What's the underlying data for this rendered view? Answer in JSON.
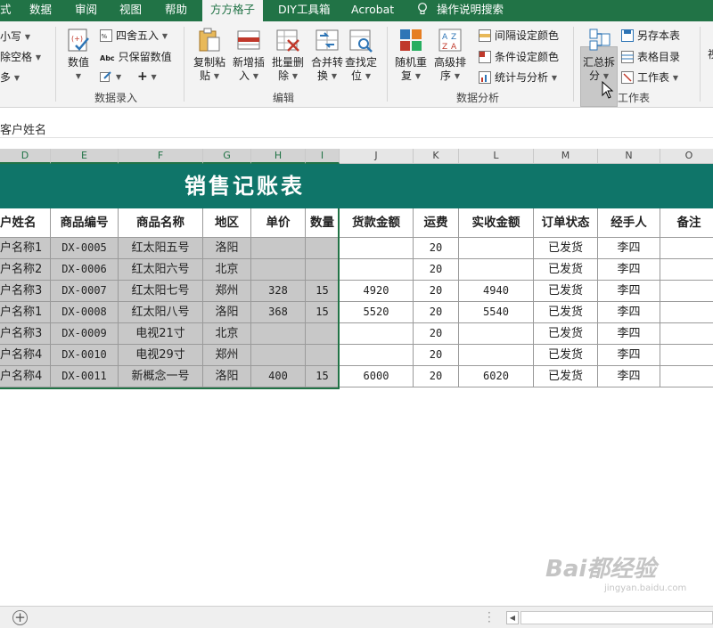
{
  "tabs": [
    "式",
    "数据",
    "审阅",
    "视图",
    "帮助",
    "方方格子",
    "DIY工具箱",
    "Acrobat",
    "操作说明搜索"
  ],
  "ribbon": {
    "left_items": [
      "小写",
      "除空格",
      "多"
    ],
    "numbers_btn": "数值",
    "round_btn": "四舍五入",
    "keep_values_btn": "只保留数值",
    "abc_label": "Abc",
    "plus_label": "+",
    "group_data_entry": "数据录入",
    "edit_buttons": [
      {
        "l1": "复制粘",
        "l2": "贴"
      },
      {
        "l1": "新增插",
        "l2": "入"
      },
      {
        "l1": "批量删",
        "l2": "除"
      },
      {
        "l1": "合并转",
        "l2": "换"
      },
      {
        "l1": "查找定",
        "l2": "位"
      }
    ],
    "group_edit": "编辑",
    "analysis_buttons": [
      {
        "l1": "随机重",
        "l2": "复"
      },
      {
        "l1": "高级排",
        "l2": "序"
      }
    ],
    "analysis_items": [
      "间隔设定颜色",
      "条件设定颜色",
      "统计与分析"
    ],
    "group_analysis": "数据分析",
    "summary_btn": {
      "l1": "汇总拆",
      "l2": "分"
    },
    "sheet_items": [
      "另存本表",
      "表格目录",
      "工作表"
    ],
    "group_sheet": "工作表",
    "right_cut": "视"
  },
  "formula_bar": {
    "value": "客户姓名"
  },
  "columns": [
    "D",
    "E",
    "F",
    "G",
    "H",
    "I",
    "J",
    "K",
    "L",
    "M",
    "N",
    "O"
  ],
  "title": "销售记账表",
  "table": {
    "headers": [
      "户姓名",
      "商品编号",
      "商品名称",
      "地区",
      "单价",
      "数量",
      "货款金额",
      "运费",
      "实收金额",
      "订单状态",
      "经手人",
      "备注"
    ],
    "rows": [
      [
        "户名称1",
        "DX-0005",
        "红太阳五号",
        "洛阳",
        "",
        "",
        "",
        "20",
        "",
        "已发货",
        "李四",
        ""
      ],
      [
        "户名称2",
        "DX-0006",
        "红太阳六号",
        "北京",
        "",
        "",
        "",
        "20",
        "",
        "已发货",
        "李四",
        ""
      ],
      [
        "户名称3",
        "DX-0007",
        "红太阳七号",
        "郑州",
        "328",
        "15",
        "4920",
        "20",
        "4940",
        "已发货",
        "李四",
        ""
      ],
      [
        "户名称1",
        "DX-0008",
        "红太阳八号",
        "洛阳",
        "368",
        "15",
        "5520",
        "20",
        "5540",
        "已发货",
        "李四",
        ""
      ],
      [
        "户名称3",
        "DX-0009",
        "电视21寸",
        "北京",
        "",
        "",
        "",
        "20",
        "",
        "已发货",
        "李四",
        ""
      ],
      [
        "户名称4",
        "DX-0010",
        "电视29寸",
        "郑州",
        "",
        "",
        "",
        "20",
        "",
        "已发货",
        "李四",
        ""
      ],
      [
        "户名称4",
        "DX-0011",
        "新概念一号",
        "洛阳",
        "400",
        "15",
        "6000",
        "20",
        "6020",
        "已发货",
        "李四",
        ""
      ]
    ]
  },
  "watermark": {
    "main": "Bai都经验",
    "sub": "jingyan.baidu.com"
  },
  "colors": {
    "excel_green": "#217346",
    "title_teal": "#0f7569",
    "selection_gray": "#c8c8c8"
  }
}
